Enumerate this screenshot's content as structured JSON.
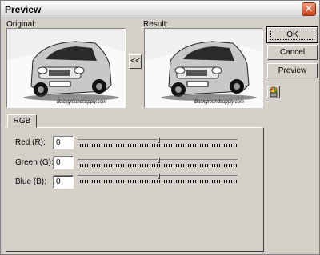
{
  "window": {
    "title": "Preview",
    "close_glyph": "✕"
  },
  "labels": {
    "original": "Original:",
    "result": "Result:"
  },
  "copy_button": {
    "glyph": "<<"
  },
  "buttons": {
    "ok": "OK",
    "cancel": "Cancel",
    "preview": "Preview"
  },
  "tools": {
    "icon": "printer-palette-icon"
  },
  "tabs": [
    {
      "label": "RGB"
    }
  ],
  "sliders": [
    {
      "label": "Red (R):",
      "value": "0",
      "level": 0.5
    },
    {
      "label": "Green (G):",
      "value": "0",
      "level": 0.5
    },
    {
      "label": "Blue (B):",
      "value": "0",
      "level": 0.5
    }
  ],
  "image_caption": "Backgroundsupply.com"
}
